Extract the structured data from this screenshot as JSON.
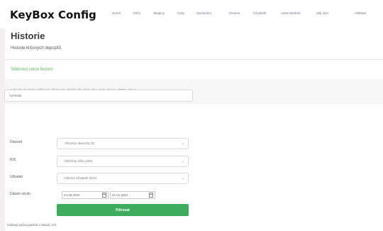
{
  "brand": "KeyBox Config",
  "nav": [
    "Domů",
    "Klíče",
    "Skupiny",
    "Časy",
    "Oprávnění",
    "Historie",
    "Uživatelé",
    "Administrátoři",
    "Můj účet",
    "Odhlásit"
  ],
  "page": {
    "title": "Historie",
    "subtitle": "Historie klíčových depozitů",
    "download_link": "Stáhnout celou historii",
    "search_info": "Vyhledat do změna: Příjmení, Číslo karty, Telefonního čísla, Tajo, Nota, Popisu, RFIDu, Stava"
  },
  "search": {
    "placeholder": "Vyhledat"
  },
  "filters": [
    {
      "label": "Deposit",
      "value": "Všechny depozity (3)"
    },
    {
      "label": "Klíč",
      "value": "Všechny klíče (245)"
    },
    {
      "label": "Uživatel",
      "value": "Všichni uživatelé (571)"
    }
  ],
  "date_range": {
    "label": "Datum od-do",
    "from": "24.08.2020",
    "to": "31.01.2021"
  },
  "filter_button": "Filtrovat",
  "total_text": "Celkový počet položek v historii: 271",
  "colors": {
    "accent": "#3dac5c",
    "link": "#5cb85c"
  },
  "icons": {
    "select": "chevron-down-icon",
    "date": "calendar-icon"
  }
}
